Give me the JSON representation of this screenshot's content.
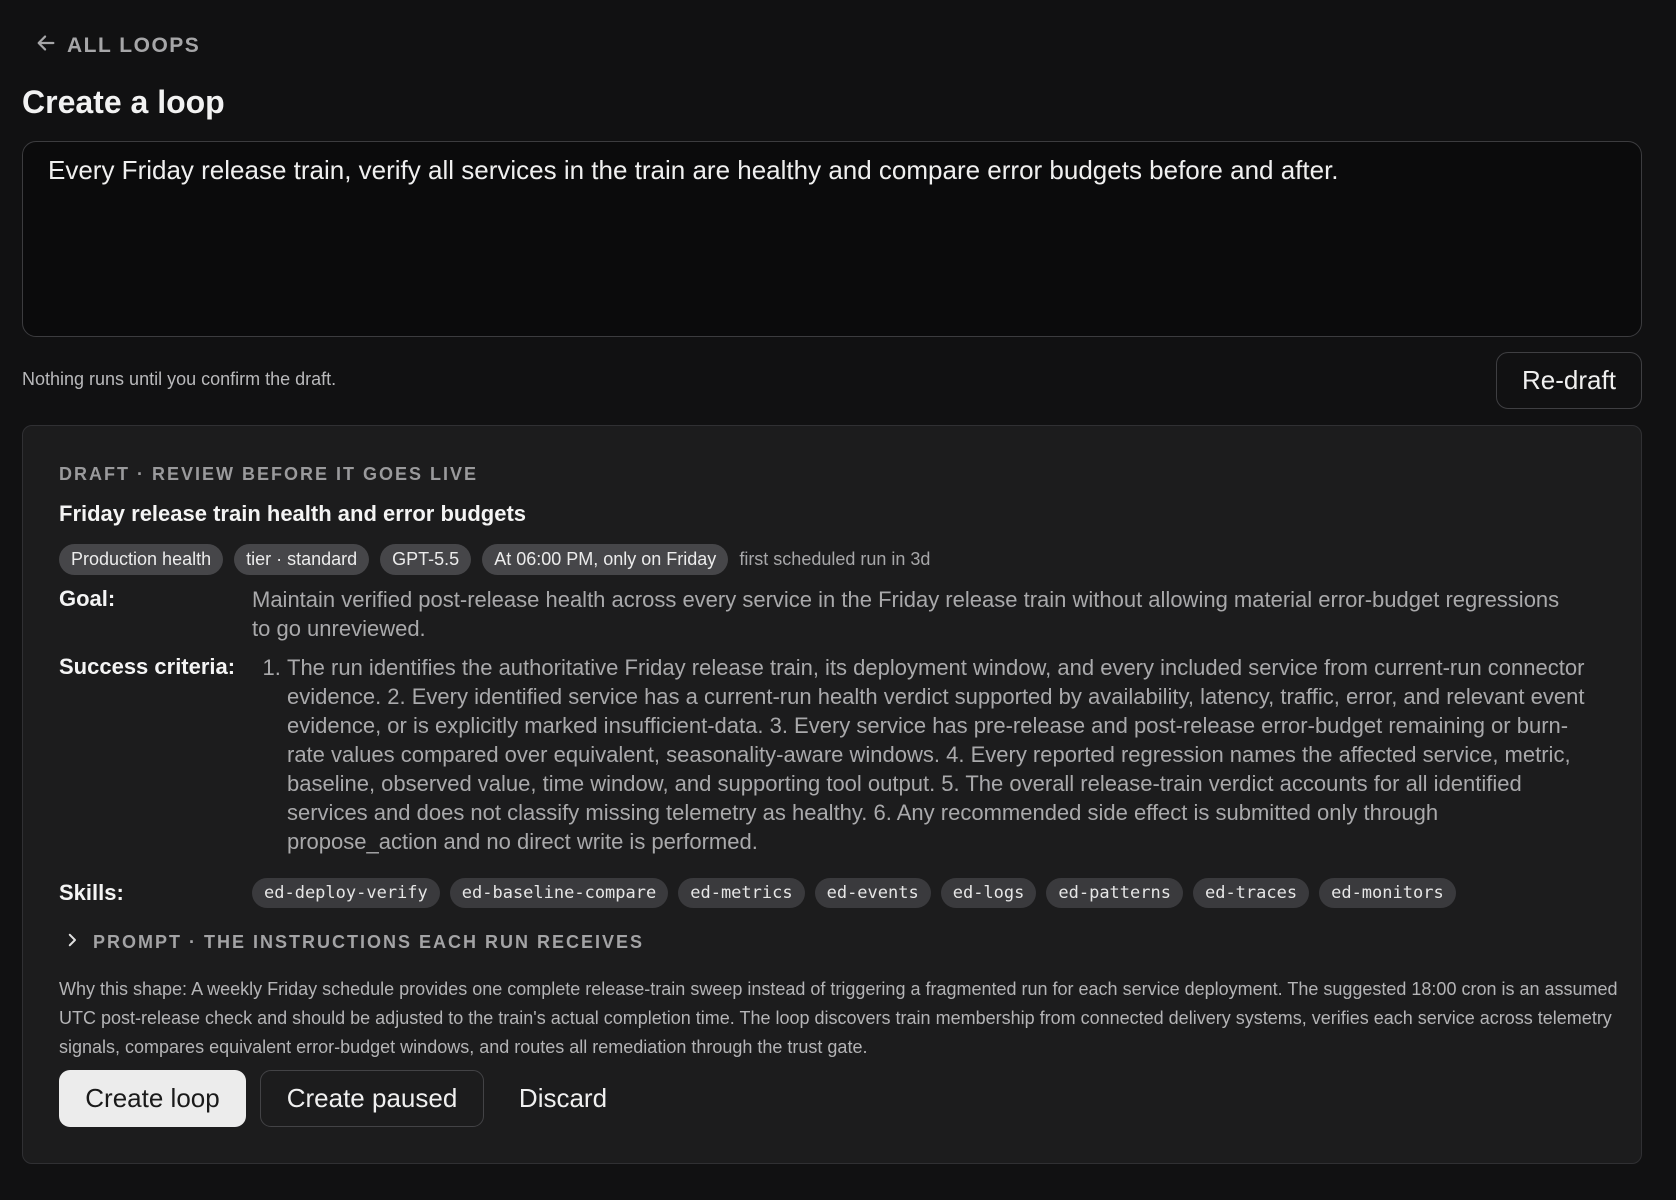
{
  "nav": {
    "back_label": "ALL LOOPS"
  },
  "page": {
    "title": "Create a loop"
  },
  "prompt": {
    "value": "Every Friday release train, verify all services in the train are healthy and compare error budgets before and after."
  },
  "note": "Nothing runs until you confirm the draft.",
  "redraft_label": "Re-draft",
  "draft": {
    "kicker": "DRAFT · REVIEW BEFORE IT GOES LIVE",
    "title": "Friday release train health and error budgets",
    "chips": [
      "Production health",
      "tier · standard",
      "GPT-5.5",
      "At 06:00 PM, only on Friday"
    ],
    "chip_note": "first scheduled run in 3d",
    "goal_label": "Goal:",
    "goal_text": "Maintain verified post-release health across every service in the Friday release train without allowing material error-budget regressions to go unreviewed.",
    "criteria_label": "Success criteria:",
    "criteria_text": "The run identifies the authoritative Friday release train, its deployment window, and every included service from current-run connector evidence. 2. Every identified service has a current-run health verdict supported by availability, latency, traffic, error, and relevant event evidence, or is explicitly marked insufficient-data. 3. Every service has pre-release and post-release error-budget remaining or burn-rate values compared over equivalent, seasonality-aware windows. 4. Every reported regression names the affected service, metric, baseline, observed value, time window, and supporting tool output. 5. The overall release-train verdict accounts for all identified services and does not classify missing telemetry as healthy. 6. Any recommended side effect is submitted only through propose_action and no direct write is performed.",
    "skills_label": "Skills:",
    "skills": [
      "ed-deploy-verify",
      "ed-baseline-compare",
      "ed-metrics",
      "ed-events",
      "ed-logs",
      "ed-patterns",
      "ed-traces",
      "ed-monitors"
    ],
    "prompt_toggle": "PROMPT · THE INSTRUCTIONS EACH RUN RECEIVES",
    "why": "Why this shape: A weekly Friday schedule provides one complete release-train sweep instead of triggering a fragmented run for each service deployment. The suggested 18:00 cron is an assumed UTC post-release check and should be adjusted to the train's actual completion time. The loop discovers train membership from connected delivery systems, verifies each service across telemetry signals, compares equivalent error-budget windows, and routes all remediation through the trust gate."
  },
  "actions": {
    "create_label": "Create loop",
    "create_paused_label": "Create paused",
    "discard_label": "Discard"
  }
}
